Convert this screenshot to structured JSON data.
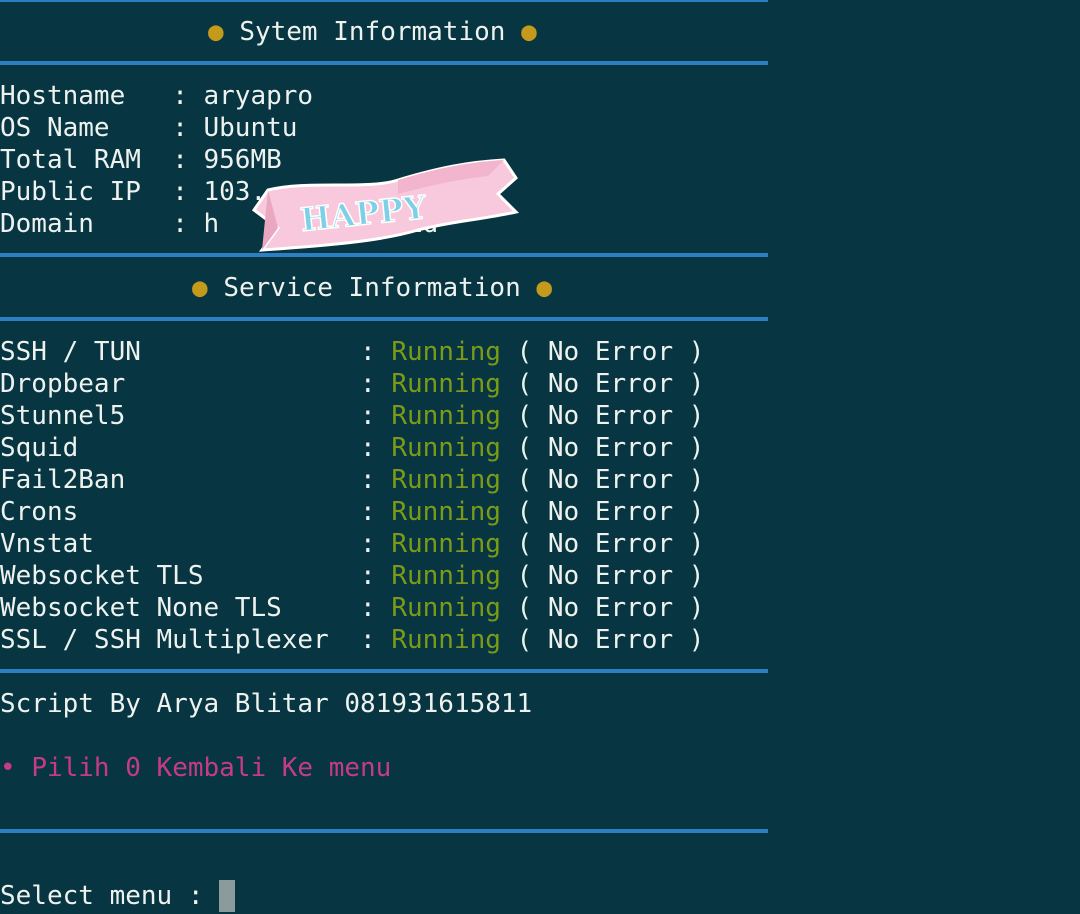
{
  "system_header": {
    "bullet": "●",
    "title": "Sytem Information"
  },
  "system_info": [
    {
      "key": "Hostname   ",
      "sep": ": ",
      "value": "aryapro"
    },
    {
      "key": "OS Name    ",
      "sep": ": ",
      "value": "Ubuntu"
    },
    {
      "key": "Total RAM  ",
      "sep": ": ",
      "value": "956MB"
    },
    {
      "key": "Public IP  ",
      "sep": ": ",
      "value": "103.        .150"
    },
    {
      "key": "Domain     ",
      "sep": ": ",
      "value": "h          z.id"
    }
  ],
  "service_header": {
    "bullet": "●",
    "title": "Service Information"
  },
  "services": [
    {
      "name": "SSH / TUN              ",
      "sep": ": ",
      "status": "Running",
      "detail": " ( No Error )"
    },
    {
      "name": "Dropbear               ",
      "sep": ": ",
      "status": "Running",
      "detail": " ( No Error )"
    },
    {
      "name": "Stunnel5               ",
      "sep": ": ",
      "status": "Running",
      "detail": " ( No Error )"
    },
    {
      "name": "Squid                  ",
      "sep": ": ",
      "status": "Running",
      "detail": " ( No Error )"
    },
    {
      "name": "Fail2Ban               ",
      "sep": ": ",
      "status": "Running",
      "detail": " ( No Error )"
    },
    {
      "name": "Crons                  ",
      "sep": ": ",
      "status": "Running",
      "detail": " ( No Error )"
    },
    {
      "name": "Vnstat                 ",
      "sep": ": ",
      "status": "Running",
      "detail": " ( No Error )"
    },
    {
      "name": "Websocket TLS          ",
      "sep": ": ",
      "status": "Running",
      "detail": " ( No Error )"
    },
    {
      "name": "Websocket None TLS     ",
      "sep": ": ",
      "status": "Running",
      "detail": " ( No Error )"
    },
    {
      "name": "SSL / SSH Multiplexer  ",
      "sep": ": ",
      "status": "Running",
      "detail": " ( No Error )"
    }
  ],
  "footer": {
    "credit": "Script By Arya Blitar 081931615811",
    "hint_bullet": "•",
    "hint": "Pilih 0 Kembali Ke menu",
    "prompt": "Select menu : "
  },
  "sticker": {
    "text": "HAPPY",
    "fill": "#f8c8dc",
    "text_color": "#7fd0e6"
  },
  "colors": {
    "background": "#073542",
    "rule": "#2d7fc4",
    "bullet": "#c49a1c",
    "running": "#7b9a18",
    "hint": "#c53b86"
  }
}
